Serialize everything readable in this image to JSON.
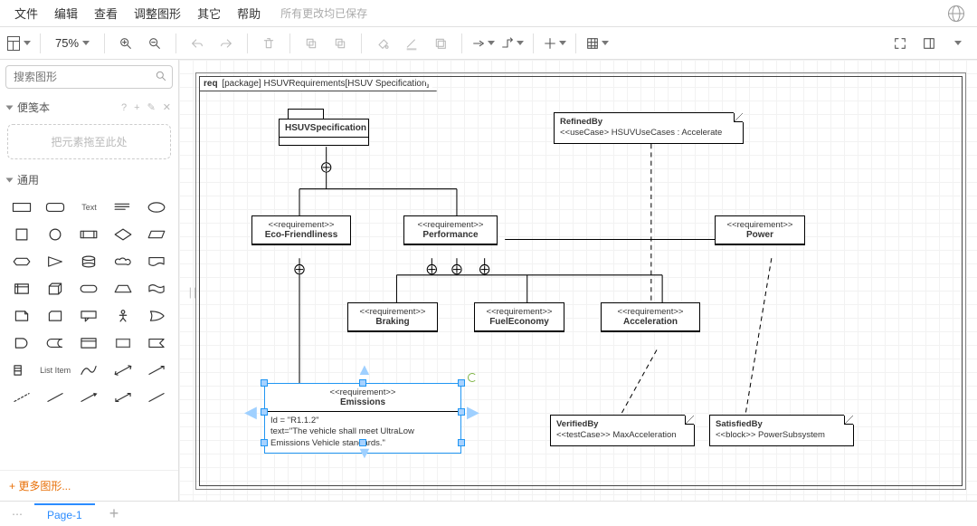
{
  "menu": {
    "file": "文件",
    "edit": "编辑",
    "view": "查看",
    "adjust": "调整图形",
    "other": "其它",
    "help": "帮助",
    "saved": "所有更改均已保存"
  },
  "toolbar": {
    "zoom": "75%"
  },
  "sidebar": {
    "search_ph": "搜索图形",
    "section_scratch": "便笺本",
    "scratch_hint": "? +",
    "dropzone": "把元素拖至此处",
    "section_general": "通用",
    "text_lbl": "Text",
    "listitem_lbl": "List Item",
    "more": "+ 更多图形..."
  },
  "footer": {
    "pages_btn": "⋯",
    "page1": "Page-1",
    "add": "+"
  },
  "diagram": {
    "frame_prefix": "req",
    "frame_label": " [package] HSUVRequirements[HSUV Specification]",
    "spec": "HSUVSpecification",
    "req_stereo": "<<requirement>>",
    "eco": "Eco-Friendliness",
    "perf": "Performance",
    "power": "Power",
    "braking": "Braking",
    "fuel": "FuelEconomy",
    "accel": "Acceleration",
    "emissions_title": "Emissions",
    "emissions_id": "Id = \"R1.1.2\"",
    "emissions_text": "text=\"The vehicle shall meet UltraLow Emissions Vehicle standards.\"",
    "refined_title": "RefinedBy",
    "refined_body": "<<useCase>  HSUVUseCases : Accelerate",
    "verified_title": "VerifiedBy",
    "verified_body": "<<testCase>>  MaxAcceleration",
    "satisfied_title": "SatisfiedBy",
    "satisfied_body": "<<block>>  PowerSubsystem"
  }
}
